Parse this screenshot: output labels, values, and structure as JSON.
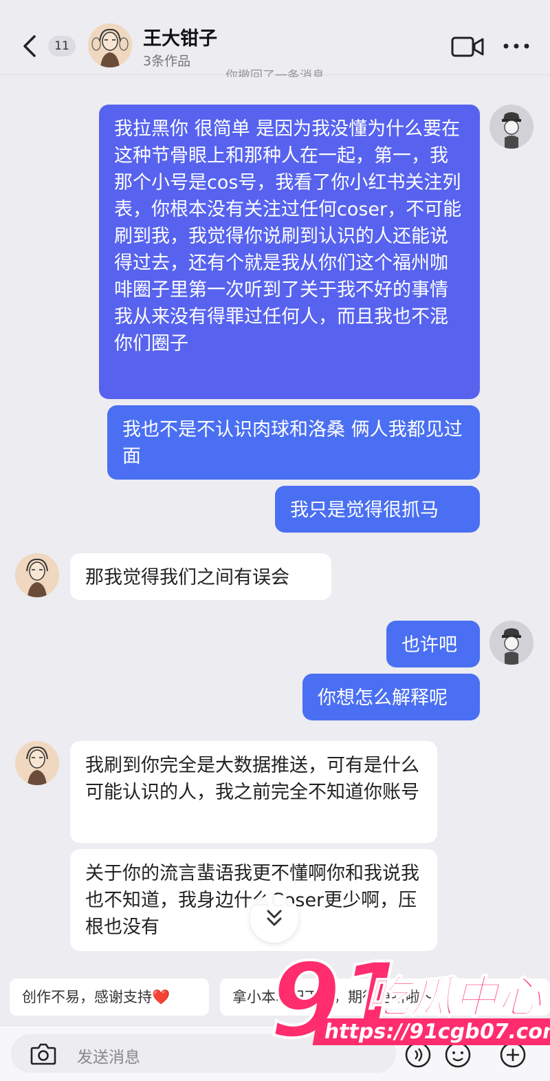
{
  "header": {
    "unread_count": "11",
    "contact_name": "王大钳子",
    "works_count": "3条作品",
    "system_note": "你撤回了一条消息"
  },
  "messages": [
    {
      "side": "me",
      "text": "我拉黑你 很简单 是因为我没懂为什么要在这种节骨眼上和那种人在一起，第一，我那个小号是cos号，我看了你小红书关注列表，你根本没有关注过任何coser，不可能刷到我，我觉得你说刷到认识的人还能说得过去，还有个就是我从你们这个福州咖啡圈子里第一次听到了关于我不好的事情 我从来没有得罪过任何人，而且我也不混你们圈子"
    },
    {
      "side": "me",
      "text": "我也不是不认识肉球和洛桑 俩人我都见过面"
    },
    {
      "side": "me",
      "text": "我只是觉得很抓马"
    },
    {
      "side": "other",
      "text": "那我觉得我们之间有误会"
    },
    {
      "side": "me",
      "text": "也许吧"
    },
    {
      "side": "me",
      "text": "你想怎么解释呢"
    },
    {
      "side": "other",
      "text": "我刷到你完全是大数据推送，可有是什么可能认识的人，我之前完全不知道你账号"
    },
    {
      "side": "other",
      "text": "关于你的流言蜚语我更不懂啊你和我说我也不知道，我身边什么Coser更少啊，压根也没有"
    }
  ],
  "quick_replies": [
    "创作不易，感谢支持❤️",
    "拿小本本记下啦，期待更新啦～"
  ],
  "input": {
    "placeholder": "发送消息"
  },
  "watermark": {
    "number": "91",
    "brand": "吃瓜中心",
    "url": "https://91cgb07.com"
  },
  "colors": {
    "my_bubble": "#4a6ff2",
    "other_bubble": "#ffffff",
    "background": "#ececf1",
    "watermark": "#ff2d6d"
  },
  "icons": [
    "back-arrow-icon",
    "video-call-icon",
    "more-icon",
    "camera-icon",
    "voice-icon",
    "emoji-icon",
    "plus-icon",
    "chevron-down-icon"
  ]
}
